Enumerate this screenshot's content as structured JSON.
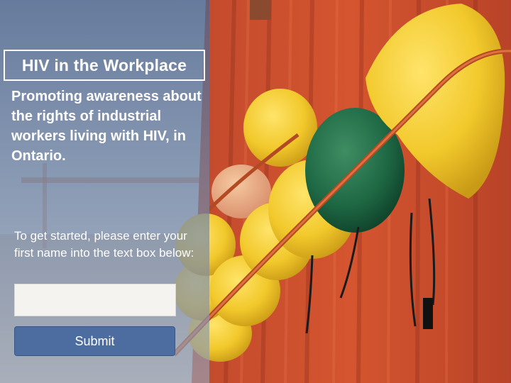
{
  "page": {
    "title": "HIV in the Workplace",
    "subtitle": "Promoting awareness about the rights of industrial workers living with HIV, in Ontario.",
    "instructions": "To get started, please enter your first name into the text box below:"
  },
  "form": {
    "name_value": "",
    "name_placeholder": "",
    "submit_label": "Submit"
  },
  "colors": {
    "panel_overlay": "#5a7099",
    "button": "#4d6da1",
    "container_red": "#c94a2a",
    "helmet_yellow": "#f2cb2c",
    "helmet_green": "#1f6a45"
  },
  "background_image": {
    "subject": "hard-hats-on-shipping-container",
    "icon": "hard-hat-icon"
  }
}
